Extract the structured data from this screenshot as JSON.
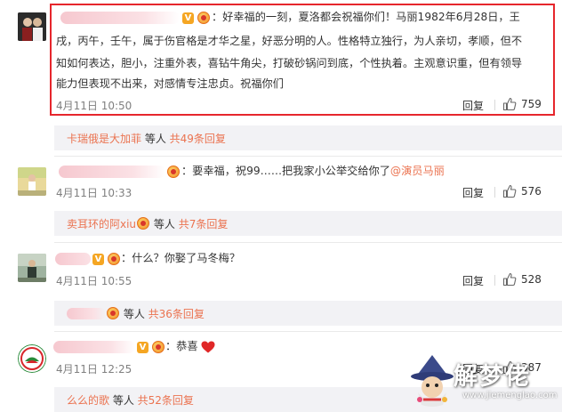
{
  "comments": [
    {
      "text": [
        "：好幸福的一刻，夏洛都会祝福你们！马丽1982年6月28日，王",
        "戌，丙午，壬午，属于伤官格是才华之星，好恶分明的人。性格特立独行，为人亲切，孝顺，但不",
        "知如何表达，胆小，注重外表，喜钻牛角尖，打破砂锅问到底，个性执着。主观意识重，但有领导",
        "能力但表现不出来，对感情专注忠贞。祝福你们"
      ],
      "time": "4月11日 10:50",
      "reply_label": "回复",
      "likes": "759",
      "sub": {
        "user": "卡瑞俄是大加菲",
        "mid": " 等人 ",
        "count": "共49条回复"
      }
    },
    {
      "text_prefix": "：要幸福，祝99……把我家小公举交给你了",
      "mention": "@演员马丽",
      "time": "4月11日 10:33",
      "reply_label": "回复",
      "likes": "576",
      "sub": {
        "user": "卖耳环的阿xiu",
        "mid": " 等人 ",
        "count": "共7条回复"
      }
    },
    {
      "text": "：什么？你娶了马冬梅？",
      "time": "4月11日 10:55",
      "reply_label": "回复",
      "likes": "528",
      "sub": {
        "user": "",
        "mid": " 等人 ",
        "count": "共36条回复"
      }
    },
    {
      "text": "：恭喜",
      "time": "4月11日 12:25",
      "reply_label": "回复",
      "likes": "387",
      "sub": {
        "user": "么么的歌",
        "mid": " 等人 ",
        "count": "共52条回复"
      }
    }
  ],
  "badge_letter": "V",
  "watermark": {
    "title": "解梦佬",
    "url": "www.jiemenglao.com"
  },
  "colors": {
    "highlight": "#e6262c",
    "link": "#eb7350",
    "sub_bg": "#f2f2f5"
  }
}
